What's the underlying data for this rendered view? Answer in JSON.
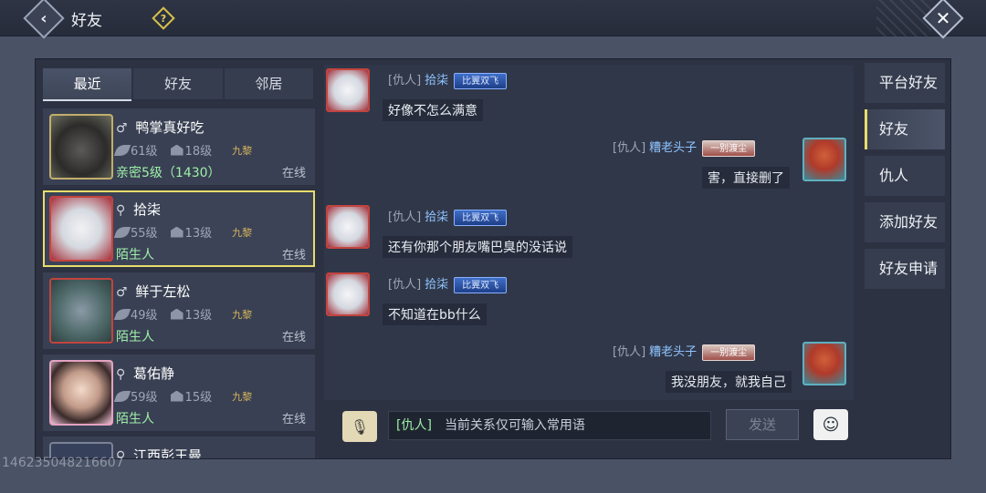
{
  "header": {
    "title": "好友",
    "back_icon": "‹",
    "help_icon": "?",
    "close_icon": "✕"
  },
  "tabs": [
    {
      "label": "最近",
      "active": true
    },
    {
      "label": "好友",
      "active": false
    },
    {
      "label": "邻居",
      "active": false
    }
  ],
  "friends": [
    {
      "name": "鸭掌真好吃",
      "gender_icon": "♂",
      "level": "61级",
      "house": "18级",
      "guild": "九黎",
      "relation": "亲密5级（1430）",
      "status": "在线"
    },
    {
      "name": "拾柒",
      "gender_icon": "⚲",
      "level": "55级",
      "house": "13级",
      "guild": "九黎",
      "relation": "陌生人",
      "status": "在线"
    },
    {
      "name": "鲜于左松",
      "gender_icon": "♂",
      "level": "49级",
      "house": "13级",
      "guild": "九黎",
      "relation": "陌生人",
      "status": "在线"
    },
    {
      "name": "葛佑静",
      "gender_icon": "⚲",
      "level": "59级",
      "house": "15级",
      "guild": "九黎",
      "relation": "陌生人",
      "status": "在线"
    },
    {
      "name": "江西彭王曼",
      "gender_icon": "⚲"
    }
  ],
  "watermark": "146235048216607",
  "messages": [
    {
      "side": "left",
      "tag": "[仇人]",
      "name": "拾柒",
      "badge": "比翼双飞",
      "text": "好像不怎么满意"
    },
    {
      "side": "right",
      "tag": "[仇人]",
      "name": "糟老头子",
      "badge": "一别渡尘",
      "text": "害，直接删了"
    },
    {
      "side": "left",
      "tag": "[仇人]",
      "name": "拾柒",
      "badge": "比翼双飞",
      "text": "还有你那个朋友嘴巴臭的没话说"
    },
    {
      "side": "left",
      "tag": "[仇人]",
      "name": "拾柒",
      "badge": "比翼双飞",
      "text": "不知道在bb什么"
    },
    {
      "side": "right",
      "tag": "[仇人]",
      "name": "糟老头子",
      "badge": "一别渡尘",
      "text": "我没朋友，就我自己"
    }
  ],
  "input": {
    "tag": "[仇人]",
    "placeholder": "当前关系仅可输入常用语",
    "send_label": "发送",
    "voice_icon": "🎙",
    "emoji_icon": "☺"
  },
  "side_menu": [
    {
      "label": "平台好友",
      "active": false
    },
    {
      "label": "好友",
      "active": true
    },
    {
      "label": "仇人",
      "active": false
    },
    {
      "label": "添加好友",
      "active": false
    },
    {
      "label": "好友申请",
      "active": false
    }
  ]
}
